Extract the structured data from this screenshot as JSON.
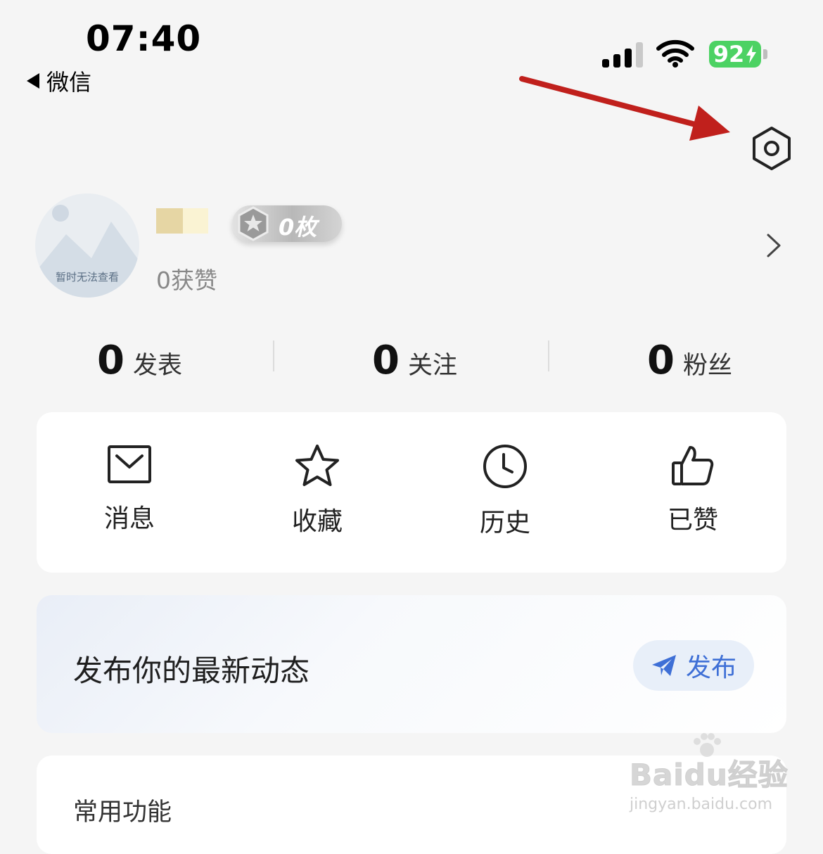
{
  "status_bar": {
    "time": "07:40",
    "battery": "92"
  },
  "nav": {
    "back_label": "微信"
  },
  "profile": {
    "avatar_text": "暂时无法查看",
    "medal_count": "0枚",
    "likes": "0获赞"
  },
  "stats": [
    {
      "value": "0",
      "label": "发表"
    },
    {
      "value": "0",
      "label": "关注"
    },
    {
      "value": "0",
      "label": "粉丝"
    }
  ],
  "quick_actions": [
    {
      "label": "消息",
      "icon": "mail-icon"
    },
    {
      "label": "收藏",
      "icon": "star-icon"
    },
    {
      "label": "历史",
      "icon": "clock-icon"
    },
    {
      "label": "已赞",
      "icon": "thumbs-up-icon"
    }
  ],
  "post": {
    "prompt": "发布你的最新动态",
    "button_label": "发布"
  },
  "common": {
    "title": "常用功能"
  },
  "watermark": {
    "main": "Baidu经验",
    "sub": "jingyan.baidu.com"
  },
  "colors": {
    "annotation_arrow": "#c0201c",
    "post_button_text": "#3e6fd6",
    "battery": "#4cd263"
  }
}
